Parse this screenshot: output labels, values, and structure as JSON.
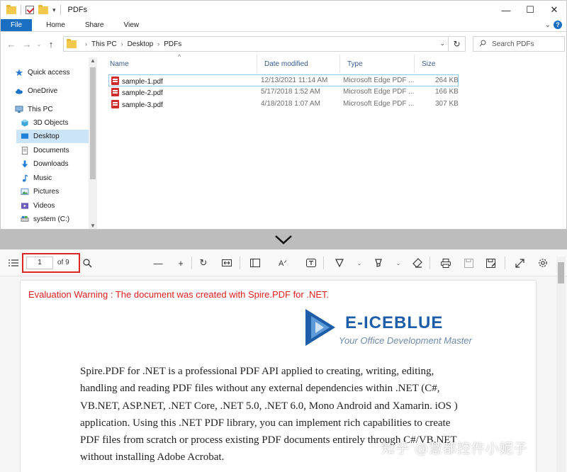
{
  "explorer": {
    "title": "PDFs",
    "ribbon_tabs": [
      "File",
      "Home",
      "Share",
      "View"
    ],
    "breadcrumb": [
      "This PC",
      "Desktop",
      "PDFs"
    ],
    "search_placeholder": "Search PDFs",
    "sidebar_items": [
      {
        "label": "Quick access",
        "icon": "star-icon"
      },
      {
        "label": "OneDrive",
        "icon": "cloud-icon"
      },
      {
        "label": "This PC",
        "icon": "computer-icon"
      },
      {
        "label": "3D Objects",
        "icon": "cube-icon"
      },
      {
        "label": "Desktop",
        "icon": "desktop-icon",
        "selected": true
      },
      {
        "label": "Documents",
        "icon": "document-icon"
      },
      {
        "label": "Downloads",
        "icon": "download-icon"
      },
      {
        "label": "Music",
        "icon": "music-icon"
      },
      {
        "label": "Pictures",
        "icon": "picture-icon"
      },
      {
        "label": "Videos",
        "icon": "video-icon"
      },
      {
        "label": "system (C:)",
        "icon": "drive-icon"
      }
    ],
    "columns": [
      "Name",
      "Date modified",
      "Type",
      "Size"
    ],
    "files": [
      {
        "name": "sample-1.pdf",
        "date": "12/13/2021 11:14 AM",
        "type": "Microsoft Edge PDF ...",
        "size": "264 KB",
        "selected": true
      },
      {
        "name": "sample-2.pdf",
        "date": "5/17/2018 1:52 AM",
        "type": "Microsoft Edge PDF ...",
        "size": "166 KB"
      },
      {
        "name": "sample-3.pdf",
        "date": "4/18/2018 1:07 AM",
        "type": "Microsoft Edge PDF ...",
        "size": "307 KB"
      }
    ]
  },
  "viewer": {
    "page_number": "1",
    "page_of": "of 9",
    "warning": "Evaluation Warning : The document was created with Spire.PDF for .NET.",
    "brand": "E-ICEBLUE",
    "tagline": "Your Office Development Master",
    "body_lines": [
      "Spire.PDF for .NET is a professional PDF API applied to creating, writing, editing,",
      "handling and reading PDF files without any external dependencies within .NET (C#,",
      "VB.NET, ASP.NET, .NET Core, .NET 5.0, .NET 6.0, Mono Android and Xamarin. iOS )",
      "application. Using this .NET PDF library, you can implement rich capabilities to create",
      "PDF files from scratch or process existing PDF documents entirely through C#/VB.NET",
      "without installing Adobe Acrobat."
    ]
  },
  "watermark": "知乎 @慧都控件小妮子",
  "colors": {
    "accent": "#1a6fc2",
    "highlight_box": "#d9262b",
    "warning_text": "#e02020",
    "brand_blue": "#1e5ea8",
    "selection": "#cce4f7"
  }
}
